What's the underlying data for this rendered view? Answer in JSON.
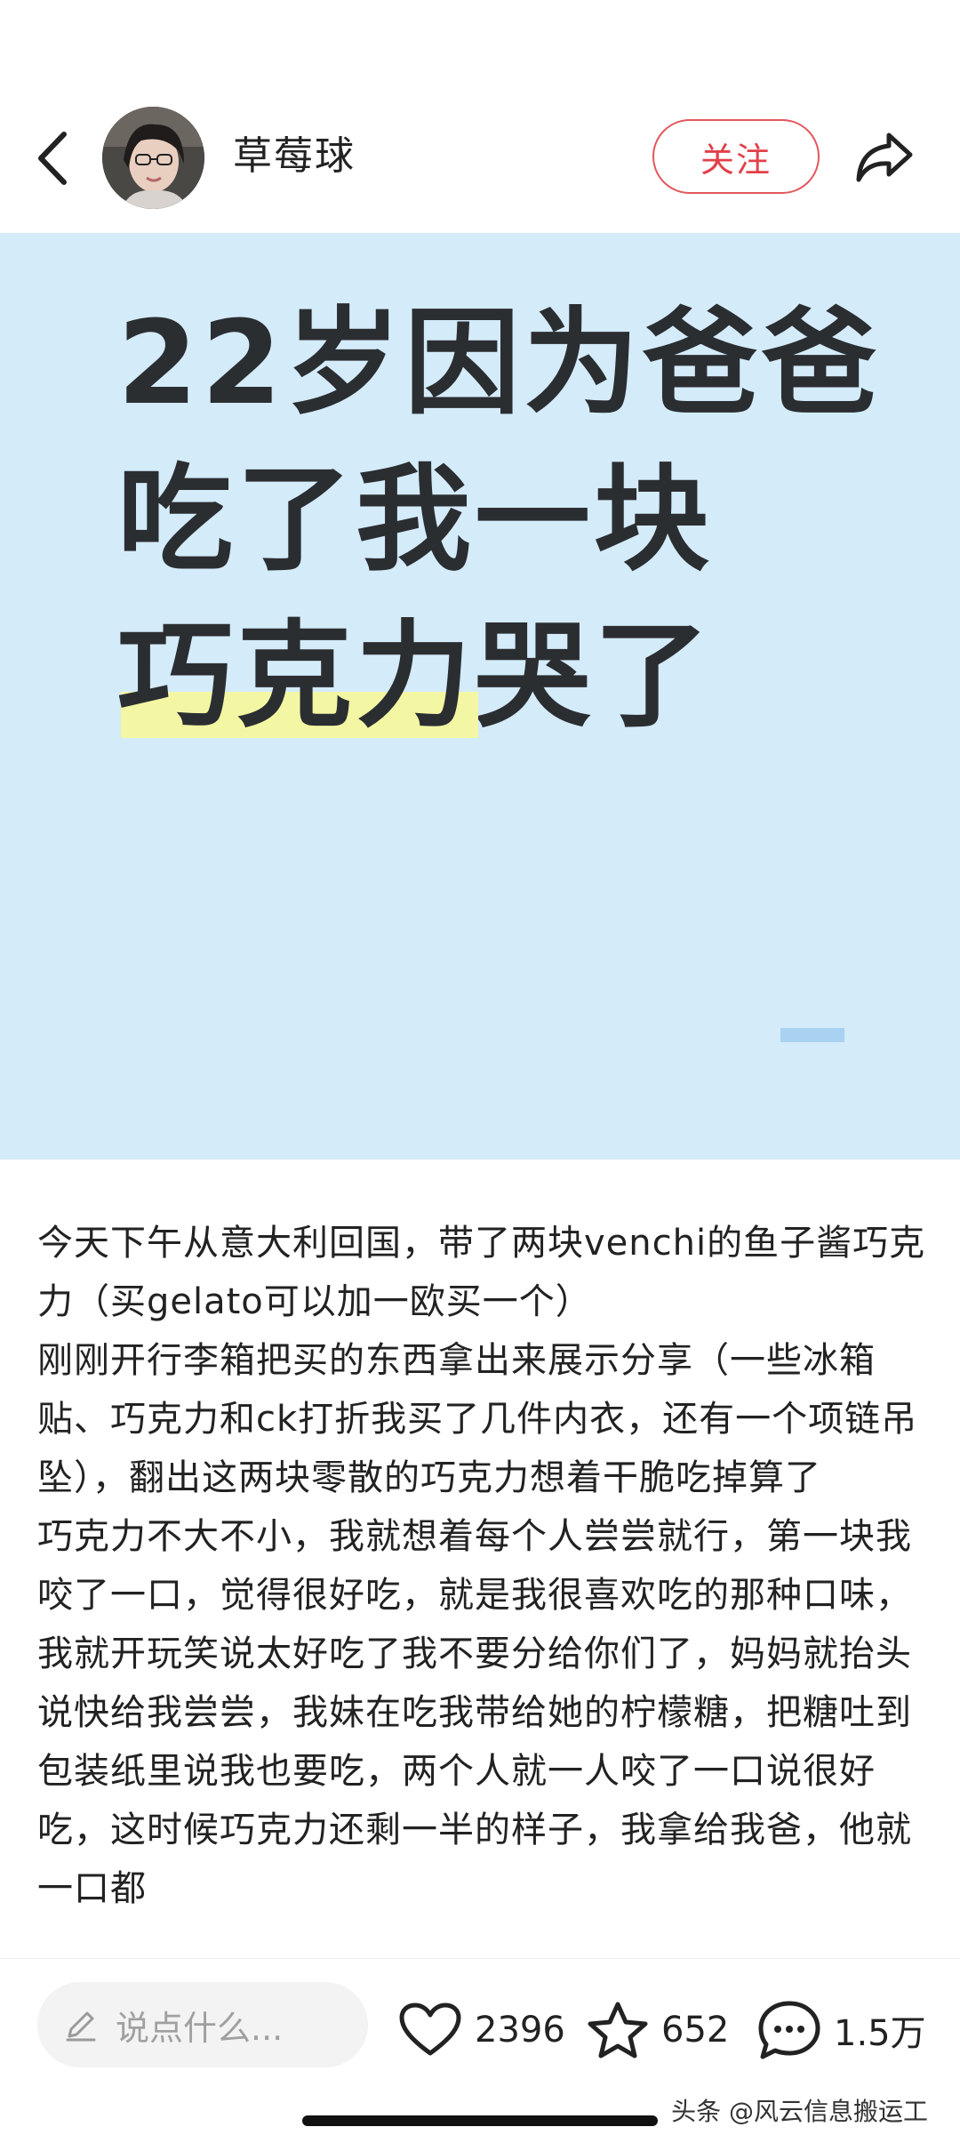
{
  "header": {
    "back_icon": "back-chevron-icon",
    "author_name": "草莓球",
    "follow_label": "关注",
    "share_icon": "share-arrow-icon",
    "follow_color": "#e2404a"
  },
  "cover": {
    "background_color": "#d4ebfa",
    "title_lines": [
      "22岁因为爸爸",
      "吃了我一块"
    ],
    "title_line3_highlight": "巧克力",
    "title_line3_rest": "哭了",
    "highlight_color": "#f3f7a3"
  },
  "article": {
    "paragraphs": [
      "今天下午从意大利回国，带了两块venchi的鱼子酱巧克力（买gelato可以加一欧买一个）",
      "刚刚开行李箱把买的东西拿出来展示分享（一些冰箱贴、巧克力和ck打折我买了几件内衣，还有一个项链吊坠），翻出这两块零散的巧克力想着干脆吃掉算了",
      "巧克力不大不小，我就想着每个人尝尝就行，第一块我咬了一口，觉得很好吃，就是我很喜欢吃的那种口味，我就开玩笑说太好吃了我不要分给你们了，妈妈就抬头说快给我尝尝，我妹在吃我带给她的柠檬糖，把糖吐到包装纸里说我也要吃，两个人就一人咬了一口说很好吃，这时候巧克力还剩一半的样子，我拿给我爸，他就一口都"
    ]
  },
  "bottom_bar": {
    "comment_placeholder": "说点什么...",
    "pen_icon": "pencil-icon",
    "like_icon": "heart-icon",
    "like_count": "2396",
    "favorite_icon": "star-icon",
    "favorite_count": "652",
    "comment_icon": "comment-bubble-icon",
    "comment_count": "1.5万",
    "watermark": "头条 @风云信息搬运工"
  }
}
